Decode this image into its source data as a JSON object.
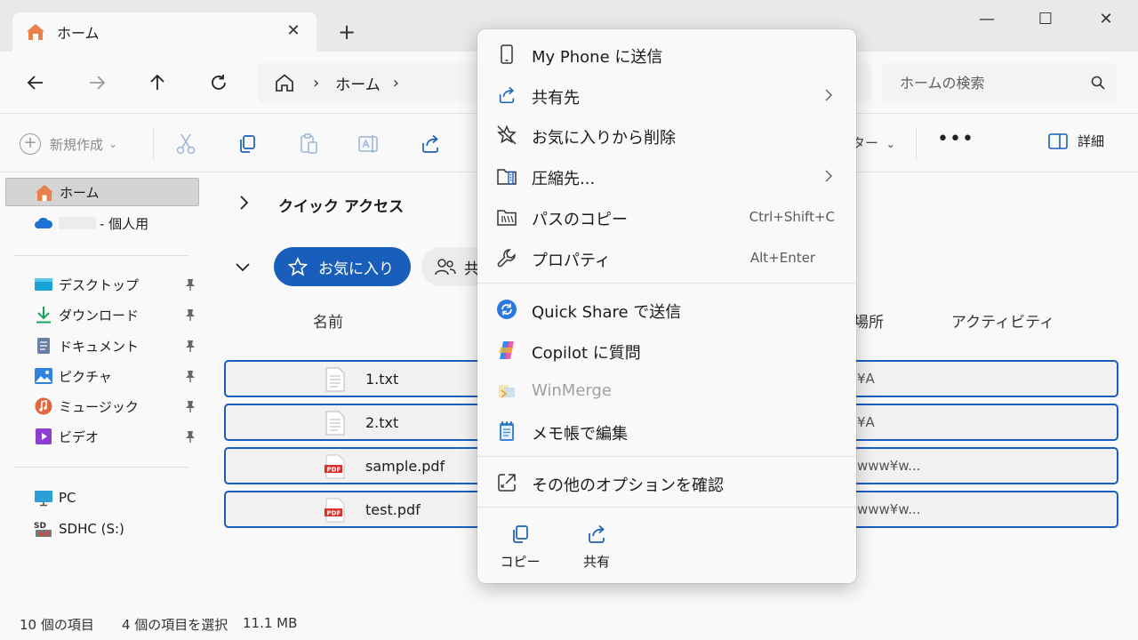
{
  "tab": {
    "title": "ホーム",
    "close_glyph": "✕",
    "new_tab_glyph": "+"
  },
  "window": {
    "minimize": "—",
    "maximize": "☐",
    "close": "✕"
  },
  "address": {
    "crumbs": [
      "ホーム"
    ],
    "separator": "›"
  },
  "search": {
    "placeholder": "ホームの検索"
  },
  "commandbar": {
    "new_label": "新規作成",
    "new_chevron": "⌄",
    "filter_fragment": "ター",
    "filter_chevron": "⌄",
    "more": "•••",
    "details_label": "詳細"
  },
  "sidebar": {
    "home": "ホーム",
    "onedrive": "- 個人用",
    "pinned": [
      {
        "label": "デスクトップ",
        "icon": "desktop-icon"
      },
      {
        "label": "ダウンロード",
        "icon": "download-icon"
      },
      {
        "label": "ドキュメント",
        "icon": "documents-icon"
      },
      {
        "label": "ピクチャ",
        "icon": "pictures-icon"
      },
      {
        "label": "ミュージック",
        "icon": "music-icon"
      },
      {
        "label": "ビデオ",
        "icon": "videos-icon"
      }
    ],
    "pc": "PC",
    "sdhc": "SDHC (S:)"
  },
  "main": {
    "quick_access": "クイック アクセス",
    "favorites_pill": "お気に入り",
    "shared_pill_fragment": "共",
    "columns": {
      "name": "名前",
      "location_fragment": "場所",
      "activity": "アクティビティ"
    },
    "files": [
      {
        "name": "1.txt",
        "type": "txt",
        "location": "¥A"
      },
      {
        "name": "2.txt",
        "type": "txt",
        "location": "¥A"
      },
      {
        "name": "sample.pdf",
        "type": "pdf",
        "location": "www¥w..."
      },
      {
        "name": "test.pdf",
        "type": "pdf",
        "location": "www¥w..."
      }
    ]
  },
  "status": {
    "count": "10 個の項目",
    "selected": "4 個の項目を選択",
    "size": "11.1 MB"
  },
  "context_menu": {
    "items": [
      {
        "label": "My Phone に送信",
        "icon": "phone-icon"
      },
      {
        "label": "共有先",
        "icon": "share-icon",
        "submenu": true
      },
      {
        "label": "お気に入りから削除",
        "icon": "star-remove-icon"
      },
      {
        "label": "圧縮先...",
        "icon": "zip-folder-icon",
        "submenu": true
      },
      {
        "label": "パスのコピー",
        "icon": "copy-path-icon",
        "shortcut": "Ctrl+Shift+C"
      },
      {
        "label": "プロパティ",
        "icon": "wrench-icon",
        "shortcut": "Alt+Enter"
      },
      {
        "label": "Quick Share で送信",
        "icon": "quick-share-icon"
      },
      {
        "label": "Copilot に質問",
        "icon": "copilot-icon"
      },
      {
        "label": "WinMerge",
        "icon": "winmerge-icon",
        "disabled": true
      },
      {
        "label": "メモ帳で編集",
        "icon": "notepad-icon"
      },
      {
        "label": "その他のオプションを確認",
        "icon": "more-options-icon"
      }
    ],
    "quick_actions": [
      {
        "label": "コピー",
        "icon": "copy-icon"
      },
      {
        "label": "共有",
        "icon": "share-icon"
      }
    ]
  },
  "colors": {
    "accent": "#1a5ebc",
    "folder": "#f3b731",
    "pdf_red": "#d9302b"
  }
}
